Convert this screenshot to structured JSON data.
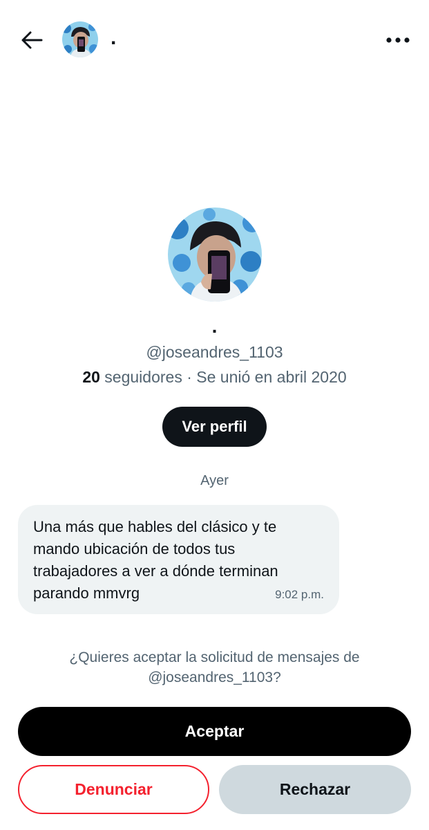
{
  "header": {
    "display_name": "."
  },
  "profile": {
    "display_name": ".",
    "handle": "@joseandres_1103",
    "followers_count": "20",
    "followers_label": "seguidores",
    "separator": "·",
    "joined": "Se unió en abril 2020",
    "view_profile_label": "Ver perfil"
  },
  "conversation": {
    "day_label": "Ayer",
    "messages": [
      {
        "text": "Una más que hables del clásico y te mando ubicación de todos tus trabajadores a ver a dónde terminan parando mmvrg",
        "time": "9:02 p.m."
      }
    ]
  },
  "request": {
    "prompt": "¿Quieres aceptar la solicitud de mensajes de @joseandres_1103?",
    "accept_label": "Aceptar",
    "report_label": "Denunciar",
    "reject_label": "Rechazar"
  },
  "colors": {
    "text_primary": "#0f1419",
    "text_secondary": "#536471",
    "bubble_bg": "#eff3f4",
    "danger": "#f4212e",
    "secondary_button": "#cfd9de",
    "primary_button": "#000000"
  },
  "icons": {
    "back": "arrow-left-icon",
    "more": "more-horizontal-icon"
  }
}
